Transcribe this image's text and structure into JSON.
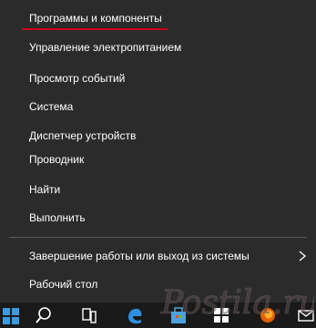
{
  "menu": {
    "items": [
      {
        "label": "Программы и компоненты"
      },
      {
        "label": "Управление электропитанием"
      },
      {
        "label": "Просмотр событий"
      },
      {
        "label": "Система"
      },
      {
        "label": "Диспетчер устройств"
      },
      {
        "label": "Проводник"
      },
      {
        "label": "Найти"
      },
      {
        "label": "Выполнить"
      },
      {
        "label": "Завершение работы или выход из системы"
      },
      {
        "label": "Рабочий стол"
      }
    ],
    "highlight_color": "#d0021b"
  },
  "taskbar": {
    "icons": [
      "windows-icon",
      "search-icon",
      "task-view-icon",
      "edge-icon",
      "store-icon",
      "start-tiles-icon",
      "firefox-icon",
      "mail-icon"
    ]
  },
  "watermark": {
    "text": "Postila.ru"
  }
}
